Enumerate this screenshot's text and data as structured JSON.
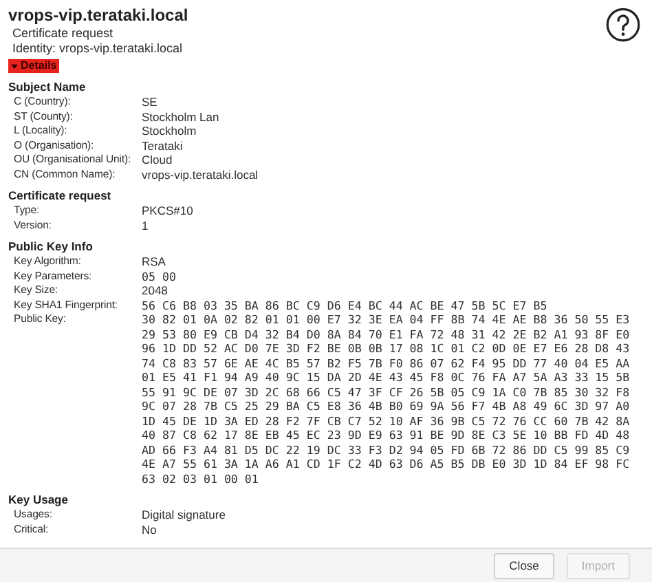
{
  "header": {
    "title": "vrops-vip.terataki.local",
    "subtitle": "Certificate request",
    "identity": "Identity: vrops-vip.terataki.local"
  },
  "details": {
    "label": "Details",
    "expanded": true
  },
  "sections": [
    {
      "heading": "Subject Name",
      "rows": [
        {
          "label": "C (Country):",
          "value": "SE"
        },
        {
          "label": "ST (County):",
          "value": "Stockholm Lan"
        },
        {
          "label": "L (Locality):",
          "value": "Stockholm"
        },
        {
          "label": "O (Organisation):",
          "value": "Terataki"
        },
        {
          "label": "OU (Organisational Unit):",
          "value": "Cloud"
        },
        {
          "label": "CN (Common Name):",
          "value": "vrops-vip.terataki.local"
        }
      ]
    },
    {
      "heading": "Certificate request",
      "rows": [
        {
          "label": "Type:",
          "value": "PKCS#10"
        },
        {
          "label": "Version:",
          "value": "1"
        }
      ]
    },
    {
      "heading": "Public Key Info",
      "rows": [
        {
          "label": "Key Algorithm:",
          "value": "RSA"
        },
        {
          "label": "Key Parameters:",
          "value": "05 00",
          "kind": "mono"
        },
        {
          "label": "Key Size:",
          "value": "2048"
        },
        {
          "label": "Key SHA1 Fingerprint:",
          "value": "56 C6 B8 03 35 BA 86 BC C9 D6 E4 BC 44 AC BE 47 5B 5C E7 B5",
          "kind": "mono"
        },
        {
          "label": "Public Key:",
          "kind": "hex",
          "lines": [
            "30 82 01 0A 02 82 01 01 00 E7 32 3E EA 04 FF 8B 74 4E AE B8 36 50 55 E3",
            "29 53 80 E9 CB D4 32 B4 D0 8A 84 70 E1 FA 72 48 31 42 2E B2 A1 93 8F E0",
            "96 1D DD 52 AC D0 7E 3D F2 BE 0B 0B 17 08 1C 01 C2 0D 0E E7 E6 28 D8 43",
            "74 C8 83 57 6E AE 4C B5 57 B2 F5 7B F0 86 07 62 F4 95 DD 77 40 04 E5 AA",
            "01 E5 41 F1 94 A9 40 9C 15 DA 2D 4E 43 45 F8 0C 76 FA A7 5A A3 33 15 5B",
            "55 91 9C DE 07 3D 2C 68 66 C5 47 3F CF 26 5B 05 C9 1A C0 7B 85 30 32 F8",
            "9C 07 28 7B C5 25 29 BA C5 E8 36 4B B0 69 9A 56 F7 4B A8 49 6C 3D 97 A0",
            "1D 45 DE 1D 3A ED 28 F2 7F CB C7 52 10 AF 36 9B C5 72 76 CC 60 7B 42 8A",
            "40 87 C8 62 17 8E EB 45 EC 23 9D E9 63 91 BE 9D 8E C3 5E 10 BB FD 4D 48",
            "AD 66 F3 A4 81 D5 DC 22 19 DC 33 F3 D2 94 05 FD 6B 72 86 DD C5 99 85 C9",
            "4E A7 55 61 3A 1A A6 A1 CD 1F C2 4D 63 D6 A5 B5 DB E0 3D 1D 84 EF 98 FC",
            "63 02 03 01 00 01"
          ]
        }
      ]
    },
    {
      "heading": "Key Usage",
      "rows": [
        {
          "label": "Usages:",
          "value": "Digital signature"
        },
        {
          "label": "Critical:",
          "value": "No"
        }
      ]
    }
  ],
  "buttons": [
    {
      "label": "Close",
      "disabled": false
    },
    {
      "label": "Import",
      "disabled": true
    }
  ]
}
